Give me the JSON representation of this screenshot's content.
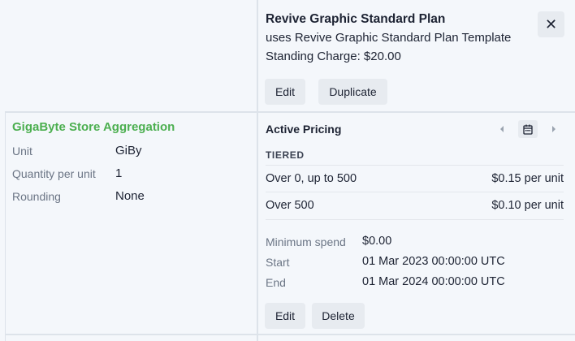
{
  "plan": {
    "title": "Revive Graphic Standard Plan",
    "template": "uses Revive Graphic Standard Plan Template",
    "standing_charge": "Standing Charge: $20.00",
    "edit_label": "Edit",
    "duplicate_label": "Duplicate",
    "close_label": "✕"
  },
  "component": {
    "title": "GigaByte Store Aggregation",
    "fields": [
      {
        "label": "Unit",
        "value": "GiBy"
      },
      {
        "label": "Quantity per unit",
        "value": "1"
      },
      {
        "label": "Rounding",
        "value": "None"
      }
    ]
  },
  "pricing": {
    "title": "Active Pricing",
    "icons": {
      "prev": "chevron-left-icon",
      "calendar": "calendar-icon",
      "next": "chevron-right-icon"
    },
    "tier_type": "TIERED",
    "tiers": [
      {
        "range": "Over 0, up to 500",
        "price": "$0.15 per unit"
      },
      {
        "range": "Over 500",
        "price": "$0.10 per unit"
      }
    ],
    "meta": [
      {
        "label": "Minimum spend",
        "value": "$0.00"
      },
      {
        "label": "Start",
        "value": "01 Mar 2023 00:00:00 UTC"
      },
      {
        "label": "End",
        "value": "01 Mar 2024 00:00:00 UTC"
      }
    ],
    "edit_label": "Edit",
    "delete_label": "Delete"
  }
}
